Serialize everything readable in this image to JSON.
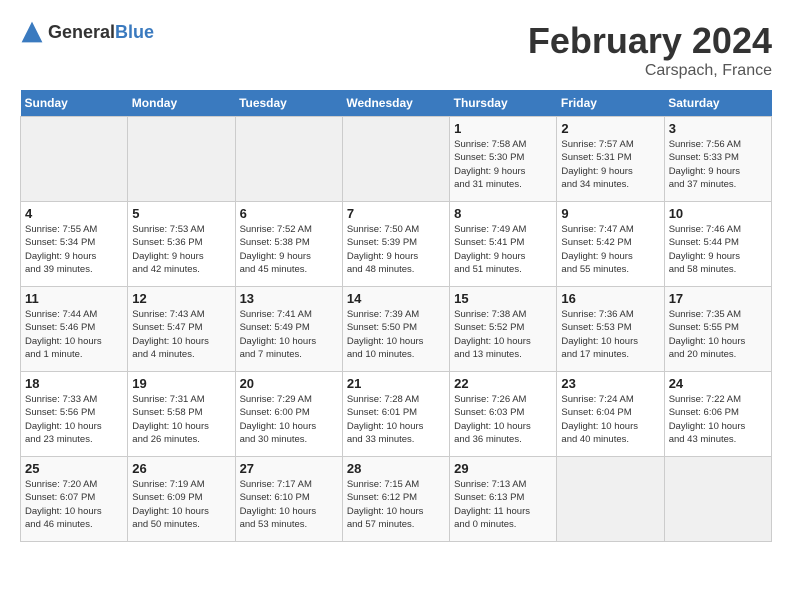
{
  "logo": {
    "general": "General",
    "blue": "Blue"
  },
  "title": "February 2024",
  "location": "Carspach, France",
  "days_header": [
    "Sunday",
    "Monday",
    "Tuesday",
    "Wednesday",
    "Thursday",
    "Friday",
    "Saturday"
  ],
  "weeks": [
    [
      {
        "day": "",
        "info": ""
      },
      {
        "day": "",
        "info": ""
      },
      {
        "day": "",
        "info": ""
      },
      {
        "day": "",
        "info": ""
      },
      {
        "day": "1",
        "info": "Sunrise: 7:58 AM\nSunset: 5:30 PM\nDaylight: 9 hours\nand 31 minutes."
      },
      {
        "day": "2",
        "info": "Sunrise: 7:57 AM\nSunset: 5:31 PM\nDaylight: 9 hours\nand 34 minutes."
      },
      {
        "day": "3",
        "info": "Sunrise: 7:56 AM\nSunset: 5:33 PM\nDaylight: 9 hours\nand 37 minutes."
      }
    ],
    [
      {
        "day": "4",
        "info": "Sunrise: 7:55 AM\nSunset: 5:34 PM\nDaylight: 9 hours\nand 39 minutes."
      },
      {
        "day": "5",
        "info": "Sunrise: 7:53 AM\nSunset: 5:36 PM\nDaylight: 9 hours\nand 42 minutes."
      },
      {
        "day": "6",
        "info": "Sunrise: 7:52 AM\nSunset: 5:38 PM\nDaylight: 9 hours\nand 45 minutes."
      },
      {
        "day": "7",
        "info": "Sunrise: 7:50 AM\nSunset: 5:39 PM\nDaylight: 9 hours\nand 48 minutes."
      },
      {
        "day": "8",
        "info": "Sunrise: 7:49 AM\nSunset: 5:41 PM\nDaylight: 9 hours\nand 51 minutes."
      },
      {
        "day": "9",
        "info": "Sunrise: 7:47 AM\nSunset: 5:42 PM\nDaylight: 9 hours\nand 55 minutes."
      },
      {
        "day": "10",
        "info": "Sunrise: 7:46 AM\nSunset: 5:44 PM\nDaylight: 9 hours\nand 58 minutes."
      }
    ],
    [
      {
        "day": "11",
        "info": "Sunrise: 7:44 AM\nSunset: 5:46 PM\nDaylight: 10 hours\nand 1 minute."
      },
      {
        "day": "12",
        "info": "Sunrise: 7:43 AM\nSunset: 5:47 PM\nDaylight: 10 hours\nand 4 minutes."
      },
      {
        "day": "13",
        "info": "Sunrise: 7:41 AM\nSunset: 5:49 PM\nDaylight: 10 hours\nand 7 minutes."
      },
      {
        "day": "14",
        "info": "Sunrise: 7:39 AM\nSunset: 5:50 PM\nDaylight: 10 hours\nand 10 minutes."
      },
      {
        "day": "15",
        "info": "Sunrise: 7:38 AM\nSunset: 5:52 PM\nDaylight: 10 hours\nand 13 minutes."
      },
      {
        "day": "16",
        "info": "Sunrise: 7:36 AM\nSunset: 5:53 PM\nDaylight: 10 hours\nand 17 minutes."
      },
      {
        "day": "17",
        "info": "Sunrise: 7:35 AM\nSunset: 5:55 PM\nDaylight: 10 hours\nand 20 minutes."
      }
    ],
    [
      {
        "day": "18",
        "info": "Sunrise: 7:33 AM\nSunset: 5:56 PM\nDaylight: 10 hours\nand 23 minutes."
      },
      {
        "day": "19",
        "info": "Sunrise: 7:31 AM\nSunset: 5:58 PM\nDaylight: 10 hours\nand 26 minutes."
      },
      {
        "day": "20",
        "info": "Sunrise: 7:29 AM\nSunset: 6:00 PM\nDaylight: 10 hours\nand 30 minutes."
      },
      {
        "day": "21",
        "info": "Sunrise: 7:28 AM\nSunset: 6:01 PM\nDaylight: 10 hours\nand 33 minutes."
      },
      {
        "day": "22",
        "info": "Sunrise: 7:26 AM\nSunset: 6:03 PM\nDaylight: 10 hours\nand 36 minutes."
      },
      {
        "day": "23",
        "info": "Sunrise: 7:24 AM\nSunset: 6:04 PM\nDaylight: 10 hours\nand 40 minutes."
      },
      {
        "day": "24",
        "info": "Sunrise: 7:22 AM\nSunset: 6:06 PM\nDaylight: 10 hours\nand 43 minutes."
      }
    ],
    [
      {
        "day": "25",
        "info": "Sunrise: 7:20 AM\nSunset: 6:07 PM\nDaylight: 10 hours\nand 46 minutes."
      },
      {
        "day": "26",
        "info": "Sunrise: 7:19 AM\nSunset: 6:09 PM\nDaylight: 10 hours\nand 50 minutes."
      },
      {
        "day": "27",
        "info": "Sunrise: 7:17 AM\nSunset: 6:10 PM\nDaylight: 10 hours\nand 53 minutes."
      },
      {
        "day": "28",
        "info": "Sunrise: 7:15 AM\nSunset: 6:12 PM\nDaylight: 10 hours\nand 57 minutes."
      },
      {
        "day": "29",
        "info": "Sunrise: 7:13 AM\nSunset: 6:13 PM\nDaylight: 11 hours\nand 0 minutes."
      },
      {
        "day": "",
        "info": ""
      },
      {
        "day": "",
        "info": ""
      }
    ]
  ]
}
